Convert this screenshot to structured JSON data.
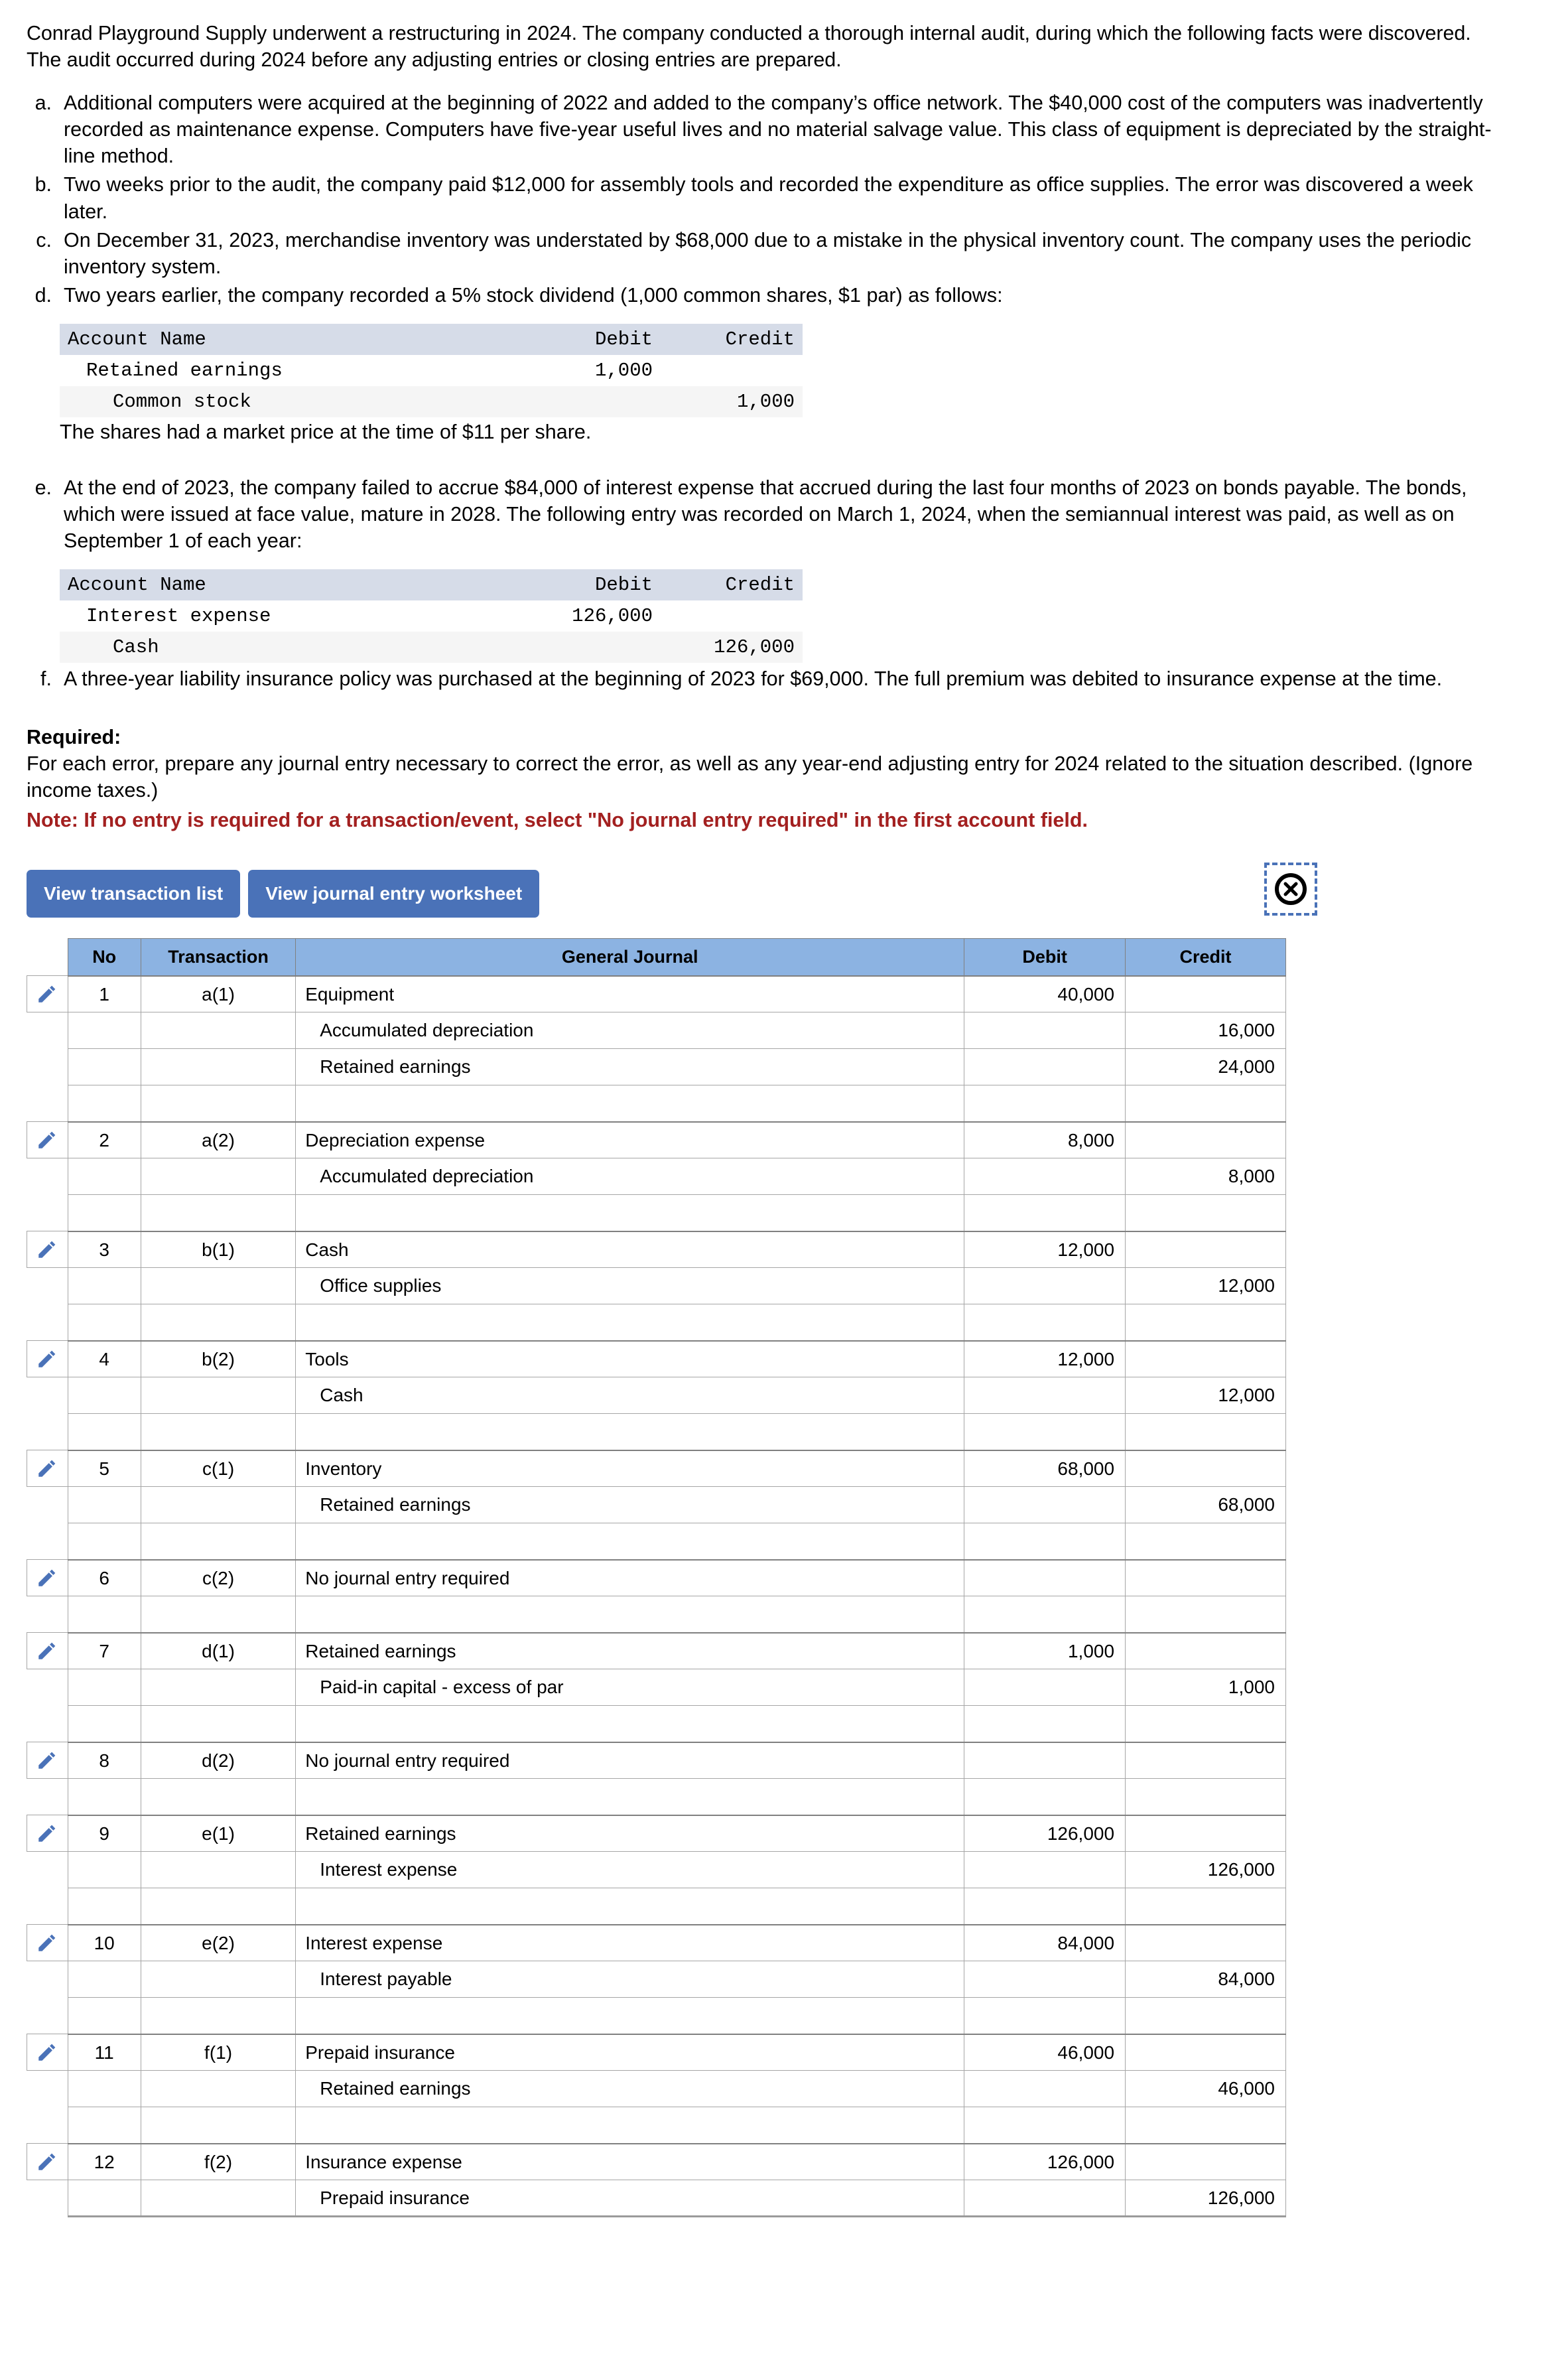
{
  "problem": {
    "intro": "Conrad Playground Supply underwent a restructuring in 2024. The company conducted a thorough internal audit, during which the following facts were discovered. The audit occurred during 2024 before any adjusting entries or closing entries are prepared.",
    "items": [
      {
        "marker": "a.",
        "text": "Additional computers were acquired at the beginning of 2022 and added to the company’s office network. The $40,000 cost of the computers was inadvertently recorded as maintenance expense. Computers have five-year useful lives and no material salvage value. This class of equipment is depreciated by the straight-line method."
      },
      {
        "marker": "b.",
        "text": "Two weeks prior to the audit, the company paid $12,000 for assembly tools and recorded the expenditure as office supplies. The error was discovered a week later."
      },
      {
        "marker": "c.",
        "text": "On December 31, 2023, merchandise inventory was understated by $68,000 due to a mistake in the physical inventory count. The company uses the periodic inventory system."
      },
      {
        "marker": "d.",
        "text": "Two years earlier, the company recorded a 5% stock dividend (1,000 common shares, $1 par) as follows:"
      },
      {
        "marker": "e.",
        "text": "At the end of 2023, the company failed to accrue $84,000 of interest expense that accrued during the last four months of 2023 on bonds payable. The bonds, which were issued at face value, mature in 2028. The following entry was recorded on March 1, 2024, when the semiannual interest was paid, as well as on September 1 of each year:"
      },
      {
        "marker": "f.",
        "text": "A three-year liability insurance policy was purchased at the beginning of 2023 for $69,000. The full premium was debited to insurance expense at the time."
      }
    ],
    "note_d": "The shares had a market price at the time of $11 per share."
  },
  "mini_table_d": {
    "headers": [
      "Account Name",
      "Debit",
      "Credit"
    ],
    "rows": [
      {
        "account": "Retained earnings",
        "indent": 1,
        "debit": "1,000",
        "credit": ""
      },
      {
        "account": "Common stock",
        "indent": 2,
        "debit": "",
        "credit": "1,000"
      }
    ]
  },
  "mini_table_e": {
    "headers": [
      "Account Name",
      "Debit",
      "Credit"
    ],
    "rows": [
      {
        "account": "Interest expense",
        "indent": 1,
        "debit": "126,000",
        "credit": ""
      },
      {
        "account": "Cash",
        "indent": 2,
        "debit": "",
        "credit": "126,000"
      }
    ]
  },
  "required": {
    "title": "Required:",
    "body": "For each error, prepare any journal entry necessary to correct the error, as well as any year-end adjusting entry for 2024 related to the situation described. (Ignore income taxes.)",
    "note": "Note: If no entry is required for a transaction/event, select \"No journal entry required\" in the first account field."
  },
  "toolbar": {
    "view_transaction_list": "View transaction list",
    "view_journal_entry_worksheet": "View journal entry worksheet",
    "close_icon_name": "circle-x-icon"
  },
  "journal": {
    "headers": [
      "No",
      "Transaction",
      "General Journal",
      "Debit",
      "Credit"
    ],
    "entries": [
      {
        "no": "1",
        "transaction": "a(1)",
        "lines": [
          {
            "account": "Equipment",
            "indent": 0,
            "debit": "40,000",
            "credit": ""
          },
          {
            "account": "Accumulated depreciation",
            "indent": 1,
            "debit": "",
            "credit": "16,000"
          },
          {
            "account": "Retained earnings",
            "indent": 1,
            "debit": "",
            "credit": "24,000"
          },
          {
            "account": "",
            "indent": 0,
            "debit": "",
            "credit": ""
          }
        ]
      },
      {
        "no": "2",
        "transaction": "a(2)",
        "lines": [
          {
            "account": "Depreciation expense",
            "indent": 0,
            "debit": "8,000",
            "credit": ""
          },
          {
            "account": "Accumulated depreciation",
            "indent": 1,
            "debit": "",
            "credit": "8,000"
          },
          {
            "account": "",
            "indent": 0,
            "debit": "",
            "credit": ""
          }
        ]
      },
      {
        "no": "3",
        "transaction": "b(1)",
        "lines": [
          {
            "account": "Cash",
            "indent": 0,
            "debit": "12,000",
            "credit": ""
          },
          {
            "account": "Office supplies",
            "indent": 1,
            "debit": "",
            "credit": "12,000"
          },
          {
            "account": "",
            "indent": 0,
            "debit": "",
            "credit": ""
          }
        ]
      },
      {
        "no": "4",
        "transaction": "b(2)",
        "lines": [
          {
            "account": "Tools",
            "indent": 0,
            "debit": "12,000",
            "credit": ""
          },
          {
            "account": "Cash",
            "indent": 1,
            "debit": "",
            "credit": "12,000"
          },
          {
            "account": "",
            "indent": 0,
            "debit": "",
            "credit": ""
          }
        ]
      },
      {
        "no": "5",
        "transaction": "c(1)",
        "lines": [
          {
            "account": "Inventory",
            "indent": 0,
            "debit": "68,000",
            "credit": ""
          },
          {
            "account": "Retained earnings",
            "indent": 1,
            "debit": "",
            "credit": "68,000"
          },
          {
            "account": "",
            "indent": 0,
            "debit": "",
            "credit": ""
          }
        ]
      },
      {
        "no": "6",
        "transaction": "c(2)",
        "lines": [
          {
            "account": "No journal entry required",
            "indent": 0,
            "debit": "",
            "credit": ""
          },
          {
            "account": "",
            "indent": 0,
            "debit": "",
            "credit": ""
          }
        ]
      },
      {
        "no": "7",
        "transaction": "d(1)",
        "lines": [
          {
            "account": "Retained earnings",
            "indent": 0,
            "debit": "1,000",
            "credit": ""
          },
          {
            "account": "Paid-in capital - excess of par",
            "indent": 1,
            "debit": "",
            "credit": "1,000"
          },
          {
            "account": "",
            "indent": 0,
            "debit": "",
            "credit": ""
          }
        ]
      },
      {
        "no": "8",
        "transaction": "d(2)",
        "lines": [
          {
            "account": "No journal entry required",
            "indent": 0,
            "debit": "",
            "credit": ""
          },
          {
            "account": "",
            "indent": 0,
            "debit": "",
            "credit": ""
          }
        ]
      },
      {
        "no": "9",
        "transaction": "e(1)",
        "lines": [
          {
            "account": "Retained earnings",
            "indent": 0,
            "debit": "126,000",
            "credit": ""
          },
          {
            "account": "Interest expense",
            "indent": 1,
            "debit": "",
            "credit": "126,000"
          },
          {
            "account": "",
            "indent": 0,
            "debit": "",
            "credit": ""
          }
        ]
      },
      {
        "no": "10",
        "transaction": "e(2)",
        "lines": [
          {
            "account": "Interest expense",
            "indent": 0,
            "debit": "84,000",
            "credit": ""
          },
          {
            "account": "Interest payable",
            "indent": 1,
            "debit": "",
            "credit": "84,000"
          },
          {
            "account": "",
            "indent": 0,
            "debit": "",
            "credit": ""
          }
        ]
      },
      {
        "no": "11",
        "transaction": "f(1)",
        "lines": [
          {
            "account": "Prepaid insurance",
            "indent": 0,
            "debit": "46,000",
            "credit": ""
          },
          {
            "account": "Retained earnings",
            "indent": 1,
            "debit": "",
            "credit": "46,000"
          },
          {
            "account": "",
            "indent": 0,
            "debit": "",
            "credit": ""
          }
        ]
      },
      {
        "no": "12",
        "transaction": "f(2)",
        "lines": [
          {
            "account": "Insurance expense",
            "indent": 0,
            "debit": "126,000",
            "credit": ""
          },
          {
            "account": "Prepaid insurance",
            "indent": 1,
            "debit": "",
            "credit": "126,000"
          }
        ]
      }
    ]
  },
  "colors": {
    "header_blue": "#8cb3e2",
    "button_blue": "#4a72b8",
    "note_red": "#a32020",
    "mini_header_gray": "#d6dce8",
    "pencil_blue": "#4a72b8"
  }
}
